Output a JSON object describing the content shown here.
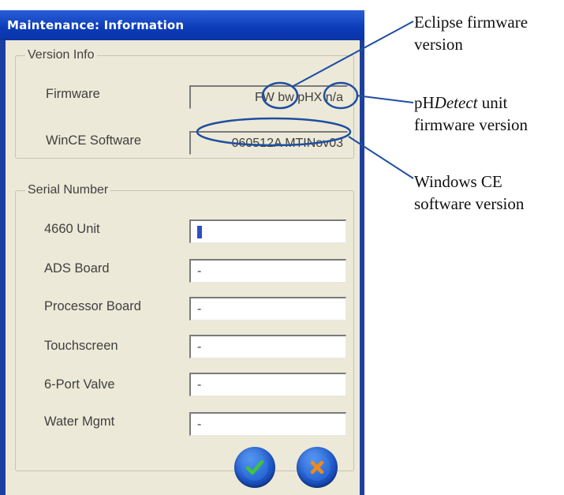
{
  "window": {
    "title": "Maintenance: Information"
  },
  "version_info": {
    "legend": "Version Info",
    "firmware": {
      "label": "Firmware",
      "value": "FW bw pHX n/a"
    },
    "wince": {
      "label": "WinCE Software",
      "value": "060512A MTINov03"
    }
  },
  "serial_number": {
    "legend": "Serial Number",
    "rows": [
      {
        "label": "4660 Unit",
        "value": ""
      },
      {
        "label": "ADS Board",
        "value": "-"
      },
      {
        "label": "Processor Board",
        "value": "-"
      },
      {
        "label": "Touchscreen",
        "value": "-"
      },
      {
        "label": "6-Port Valve",
        "value": "-"
      },
      {
        "label": "Water Mgmt",
        "value": "-"
      }
    ]
  },
  "buttons": {
    "ok_icon": "checkmark-icon",
    "cancel_icon": "x-mark-icon"
  },
  "annotations": {
    "eclipse_line1": "Eclipse firmware",
    "eclipse_line2": "version",
    "phdetect_pre": "pH",
    "phdetect_italic": "Detect",
    "phdetect_post": " unit",
    "phdetect_line2": "firmware version",
    "windows_line1": "Windows CE",
    "windows_line2": "software version"
  },
  "colors": {
    "annotation_blue": "#1f4ea0",
    "check_green": "#3ec43a",
    "cancel_orange": "#f08a1c",
    "title_bar_blue": "#0b3bb8"
  }
}
